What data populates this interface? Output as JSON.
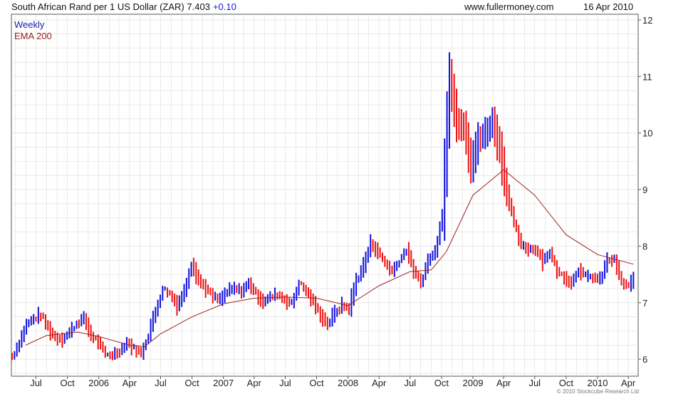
{
  "header": {
    "title": "South African Rand per 1 US Dollar (ZAR)",
    "last_value": "7.403",
    "change": "+0.10",
    "site": "www.fullermoney.com",
    "date": "16 Apr 2010"
  },
  "legend": {
    "weekly": "Weekly",
    "ema": "EMA 200"
  },
  "footer": {
    "credit": "© 2010 Stockcube Research Ltd"
  },
  "colors": {
    "up": "#1010dd",
    "down": "#ee1111",
    "ema": "#a02020",
    "grid": "#dcdcdc",
    "axis": "#555555",
    "weekly_label": "#1a1ab0",
    "ema_label": "#a02020"
  },
  "chart_data": {
    "type": "line",
    "interval": "weekly",
    "x_ticks": [
      {
        "label": "Jul",
        "date": "2005-07-01"
      },
      {
        "label": "Oct",
        "date": "2005-10-01"
      },
      {
        "label": "2006",
        "date": "2006-01-01"
      },
      {
        "label": "Apr",
        "date": "2006-04-01"
      },
      {
        "label": "Jul",
        "date": "2006-07-01"
      },
      {
        "label": "Oct",
        "date": "2006-10-01"
      },
      {
        "label": "2007",
        "date": "2007-01-01"
      },
      {
        "label": "Apr",
        "date": "2007-04-01"
      },
      {
        "label": "Jul",
        "date": "2007-07-01"
      },
      {
        "label": "Oct",
        "date": "2007-10-01"
      },
      {
        "label": "2008",
        "date": "2008-01-01"
      },
      {
        "label": "Apr",
        "date": "2008-04-01"
      },
      {
        "label": "Jul",
        "date": "2008-07-01"
      },
      {
        "label": "Oct",
        "date": "2008-10-01"
      },
      {
        "label": "2009",
        "date": "2009-01-01"
      },
      {
        "label": "Apr",
        "date": "2009-04-01"
      },
      {
        "label": "Jul",
        "date": "2009-07-01"
      },
      {
        "label": "Oct",
        "date": "2009-10-01"
      },
      {
        "label": "2010",
        "date": "2010-01-01"
      },
      {
        "label": "Apr",
        "date": "2010-04-01"
      }
    ],
    "y_ticks": [
      6,
      7,
      8,
      9,
      10,
      11,
      12
    ],
    "ylim": [
      5.7,
      12.1
    ],
    "xlim": [
      "2005-04-20",
      "2010-04-30"
    ],
    "grid": true,
    "series": [
      {
        "name": "Weekly",
        "kind": "high_low_bars",
        "points": [
          [
            "2005-04-22",
            6.05
          ],
          [
            "2005-05-13",
            6.3
          ],
          [
            "2005-06-03",
            6.62
          ],
          [
            "2005-06-24",
            6.72
          ],
          [
            "2005-07-15",
            6.78
          ],
          [
            "2005-08-05",
            6.55
          ],
          [
            "2005-08-26",
            6.38
          ],
          [
            "2005-09-16",
            6.36
          ],
          [
            "2005-10-07",
            6.48
          ],
          [
            "2005-10-28",
            6.64
          ],
          [
            "2005-11-18",
            6.72
          ],
          [
            "2005-12-09",
            6.42
          ],
          [
            "2005-12-30",
            6.3
          ],
          [
            "2006-01-20",
            6.08
          ],
          [
            "2006-02-10",
            6.08
          ],
          [
            "2006-03-03",
            6.15
          ],
          [
            "2006-03-24",
            6.3
          ],
          [
            "2006-04-14",
            6.18
          ],
          [
            "2006-05-05",
            6.1
          ],
          [
            "2006-05-26",
            6.45
          ],
          [
            "2006-06-16",
            6.85
          ],
          [
            "2006-07-07",
            7.25
          ],
          [
            "2006-07-28",
            7.15
          ],
          [
            "2006-08-18",
            6.95
          ],
          [
            "2006-09-08",
            7.2
          ],
          [
            "2006-09-29",
            7.7
          ],
          [
            "2006-10-20",
            7.4
          ],
          [
            "2006-11-10",
            7.25
          ],
          [
            "2006-12-01",
            7.1
          ],
          [
            "2006-12-22",
            7.05
          ],
          [
            "2007-01-12",
            7.2
          ],
          [
            "2007-02-02",
            7.25
          ],
          [
            "2007-02-23",
            7.2
          ],
          [
            "2007-03-16",
            7.35
          ],
          [
            "2007-04-06",
            7.15
          ],
          [
            "2007-04-27",
            7.02
          ],
          [
            "2007-05-18",
            7.1
          ],
          [
            "2007-06-08",
            7.15
          ],
          [
            "2007-06-29",
            7.05
          ],
          [
            "2007-07-20",
            6.98
          ],
          [
            "2007-08-10",
            7.35
          ],
          [
            "2007-08-31",
            7.2
          ],
          [
            "2007-09-21",
            7.0
          ],
          [
            "2007-10-12",
            6.78
          ],
          [
            "2007-11-02",
            6.62
          ],
          [
            "2007-11-23",
            6.82
          ],
          [
            "2007-12-14",
            6.95
          ],
          [
            "2008-01-04",
            6.9
          ],
          [
            "2008-01-25",
            7.4
          ],
          [
            "2008-02-15",
            7.65
          ],
          [
            "2008-03-07",
            8.05
          ],
          [
            "2008-03-28",
            7.9
          ],
          [
            "2008-04-18",
            7.7
          ],
          [
            "2008-05-09",
            7.55
          ],
          [
            "2008-05-30",
            7.75
          ],
          [
            "2008-06-20",
            7.95
          ],
          [
            "2008-07-11",
            7.55
          ],
          [
            "2008-08-01",
            7.35
          ],
          [
            "2008-08-22",
            7.75
          ],
          [
            "2008-09-12",
            7.9
          ],
          [
            "2008-10-03",
            8.6
          ],
          [
            "2008-10-24",
            11.0
          ],
          [
            "2008-11-14",
            10.2
          ],
          [
            "2008-12-05",
            10.1
          ],
          [
            "2008-12-26",
            9.4
          ],
          [
            "2009-01-16",
            9.9
          ],
          [
            "2009-02-06",
            10.0
          ],
          [
            "2009-02-27",
            10.2
          ],
          [
            "2009-03-20",
            9.7
          ],
          [
            "2009-04-10",
            8.95
          ],
          [
            "2009-05-01",
            8.4
          ],
          [
            "2009-05-22",
            8.0
          ],
          [
            "2009-06-12",
            7.95
          ],
          [
            "2009-07-03",
            7.95
          ],
          [
            "2009-07-24",
            7.75
          ],
          [
            "2009-08-14",
            7.9
          ],
          [
            "2009-09-04",
            7.55
          ],
          [
            "2009-09-25",
            7.45
          ],
          [
            "2009-10-16",
            7.35
          ],
          [
            "2009-11-06",
            7.6
          ],
          [
            "2009-11-27",
            7.45
          ],
          [
            "2009-12-18",
            7.45
          ],
          [
            "2010-01-08",
            7.4
          ],
          [
            "2010-01-29",
            7.75
          ],
          [
            "2010-02-19",
            7.75
          ],
          [
            "2010-03-12",
            7.35
          ],
          [
            "2010-04-02",
            7.3
          ],
          [
            "2010-04-16",
            7.4
          ]
        ]
      },
      {
        "name": "EMA 200",
        "kind": "line",
        "points": [
          [
            "2005-06-01",
            6.25
          ],
          [
            "2005-08-01",
            6.42
          ],
          [
            "2005-11-01",
            6.48
          ],
          [
            "2006-01-01",
            6.4
          ],
          [
            "2006-04-01",
            6.25
          ],
          [
            "2006-05-15",
            6.22
          ],
          [
            "2006-07-01",
            6.45
          ],
          [
            "2006-10-01",
            6.75
          ],
          [
            "2007-01-01",
            6.98
          ],
          [
            "2007-04-01",
            7.08
          ],
          [
            "2007-07-01",
            7.1
          ],
          [
            "2007-10-01",
            7.08
          ],
          [
            "2008-01-01",
            6.95
          ],
          [
            "2008-04-01",
            7.3
          ],
          [
            "2008-07-01",
            7.55
          ],
          [
            "2008-09-01",
            7.58
          ],
          [
            "2008-10-15",
            7.9
          ],
          [
            "2009-01-01",
            8.9
          ],
          [
            "2009-04-01",
            9.35
          ],
          [
            "2009-07-01",
            8.9
          ],
          [
            "2009-10-01",
            8.2
          ],
          [
            "2010-01-01",
            7.85
          ],
          [
            "2010-04-16",
            7.68
          ]
        ]
      }
    ]
  }
}
